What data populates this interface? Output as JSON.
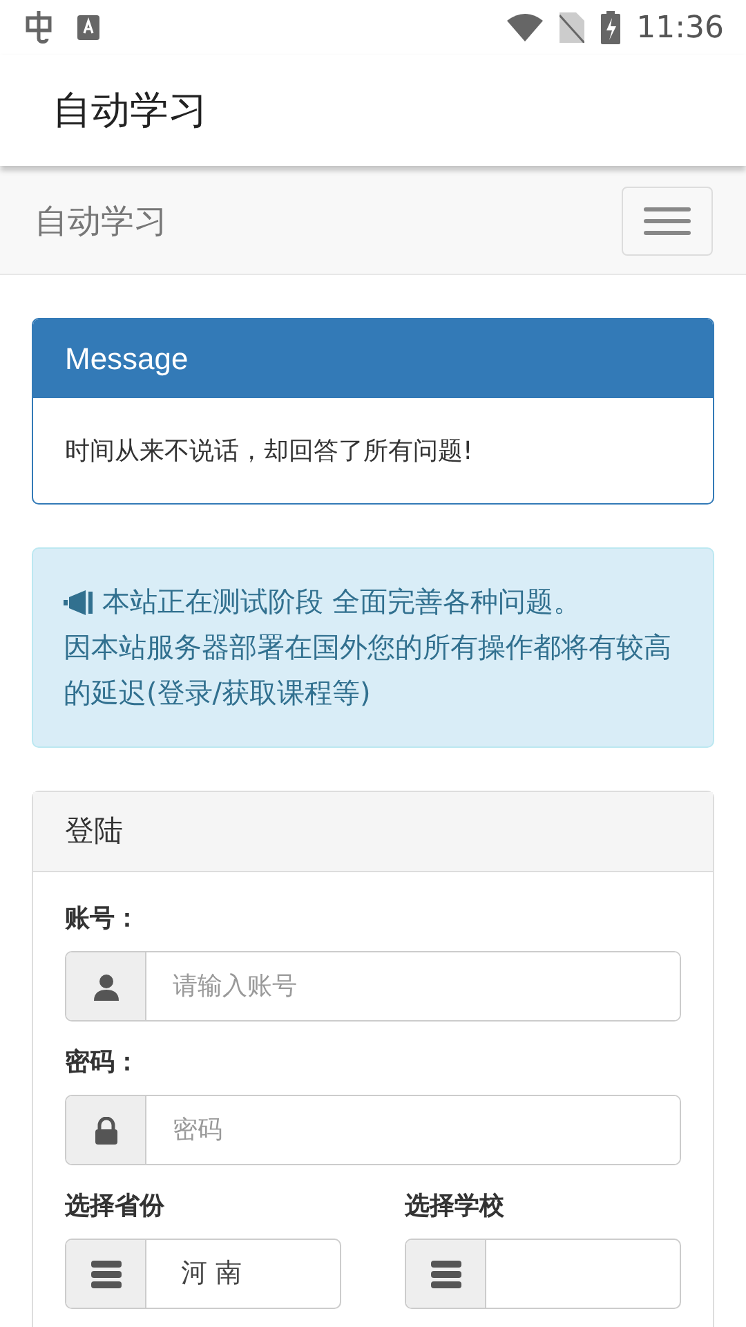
{
  "status_bar": {
    "time": "11:36"
  },
  "app_bar": {
    "title": "自动学习"
  },
  "navbar": {
    "brand": "自动学习"
  },
  "message_panel": {
    "title": "Message",
    "body": "时间从来不说话，却回答了所有问题!"
  },
  "notice": {
    "lines": [
      "本站正在测试阶段 全面完善各种问题。",
      "因本站服务器部署在国外您的所有操作都将有较高的延迟(登录/获取课程等)"
    ]
  },
  "login_panel": {
    "heading": "登陆",
    "fields": [
      {
        "label": "账号：",
        "kind": "user",
        "placeholder": "请输入账号"
      },
      {
        "label": "密码：",
        "kind": "lock",
        "placeholder": "密码"
      }
    ],
    "selects": [
      {
        "label": "选择省份",
        "kind": "list",
        "value": "河 南"
      },
      {
        "label": "选择学校",
        "kind": "list"
      }
    ]
  }
}
